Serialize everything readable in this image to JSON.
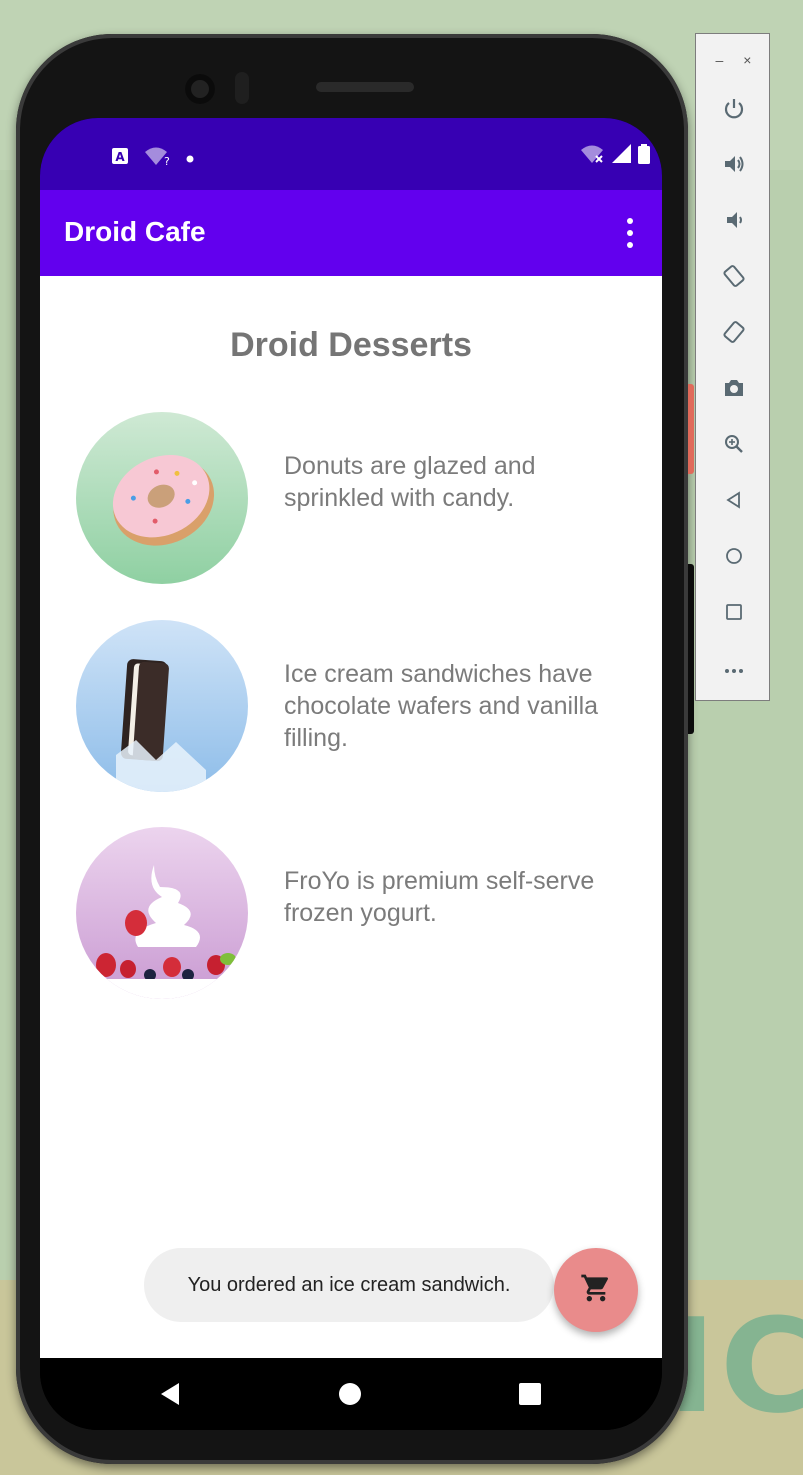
{
  "app": {
    "title": "Droid Cafe"
  },
  "page": {
    "heading": "Droid Desserts"
  },
  "desserts": [
    {
      "name": "donut",
      "description": "Donuts are glazed and sprinkled with candy."
    },
    {
      "name": "ice-cream-sandwich",
      "description": "Ice cream sandwiches have chocolate wafers and vanilla filling."
    },
    {
      "name": "froyo",
      "description": "FroYo is premium self-serve frozen yogurt."
    }
  ],
  "snackbar": {
    "message": "You ordered an ice cream sandwich."
  },
  "statusbar": {
    "icons": [
      "a-icon",
      "wifi-question-icon",
      "dot-icon",
      "wifi-x-icon",
      "signal-icon",
      "battery-icon"
    ]
  },
  "emulator_toolbar": {
    "minimize_label": "–",
    "close_label": "×",
    "buttons": [
      "power-icon",
      "volume-up-icon",
      "volume-down-icon",
      "rotate-left-icon",
      "rotate-right-icon",
      "camera-icon",
      "zoom-icon",
      "back-icon",
      "home-icon",
      "overview-icon",
      "more-icon"
    ]
  },
  "colors": {
    "status_bar": "#3700b3",
    "app_bar": "#6200ee",
    "fab": "#e98b8b",
    "snackbar": "#efefef"
  },
  "wallpaper": {
    "text": "TIC"
  }
}
